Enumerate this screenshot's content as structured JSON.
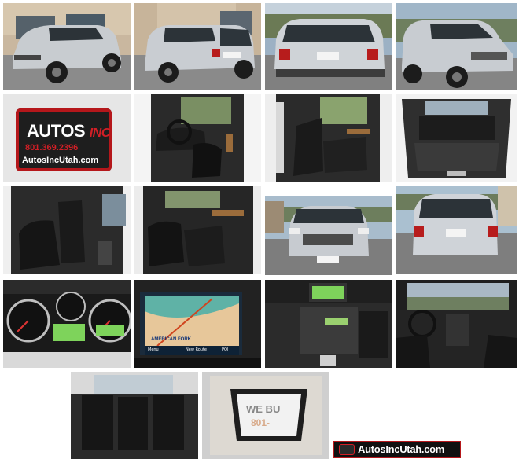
{
  "logo": {
    "brand_primary": "AUTOS",
    "brand_suffix": "INC",
    "phone": "801.369.2396",
    "url": "AutosIncUtah.com",
    "accent_color": "#d21f26"
  },
  "nav_screen": {
    "road_label": "AMERICAN FORK",
    "menu_label": "Menu",
    "new_route_label": "New Route",
    "poi_label": "POI"
  },
  "sunroof_sign": {
    "text": "WE BU",
    "number": "801-"
  },
  "banner": {
    "text": "AutosIncUtah.com"
  },
  "photos": [
    {
      "name": "exterior-front-left"
    },
    {
      "name": "exterior-rear-left"
    },
    {
      "name": "exterior-rear"
    },
    {
      "name": "exterior-front-right"
    },
    {
      "name": "dealer-logo"
    },
    {
      "name": "interior-driver-door"
    },
    {
      "name": "interior-rear-seats-door"
    },
    {
      "name": "cargo-area"
    },
    {
      "name": "rear-seats-side"
    },
    {
      "name": "front-seats-passenger"
    },
    {
      "name": "exterior-front"
    },
    {
      "name": "exterior-rear-straight"
    },
    {
      "name": "instrument-cluster"
    },
    {
      "name": "navigation-screen"
    },
    {
      "name": "center-console"
    },
    {
      "name": "dashboard-wide"
    },
    {
      "name": "rear-seats-view"
    },
    {
      "name": "sunroof"
    }
  ]
}
